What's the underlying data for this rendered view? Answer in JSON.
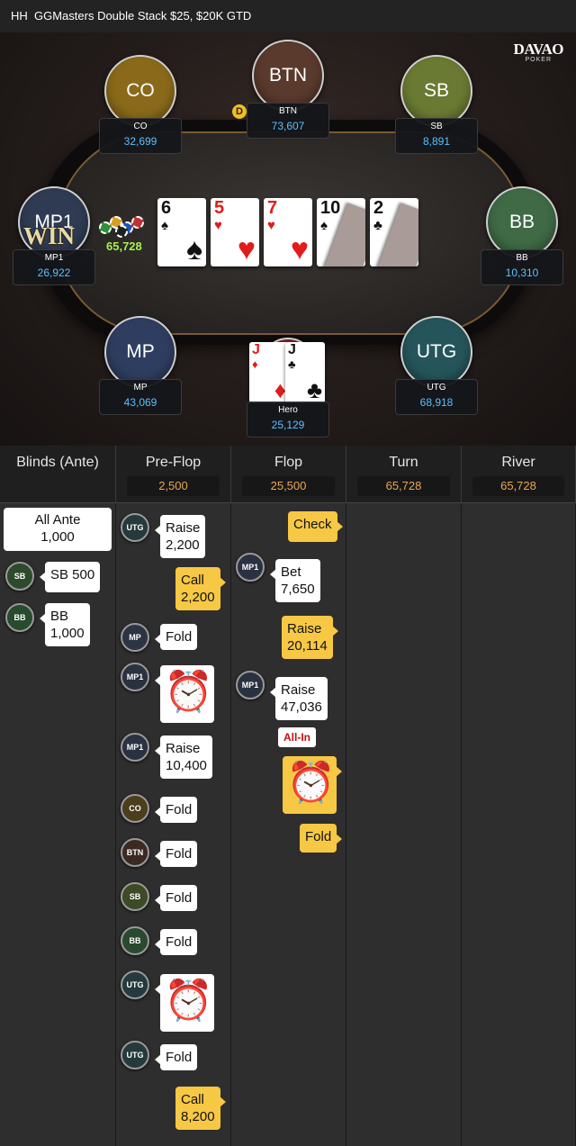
{
  "header": {
    "title": "HH  GGMasters Double Stack $25, $20K GTD"
  },
  "logo": {
    "main": "DAVAO",
    "sub": "POKER"
  },
  "seats": [
    {
      "key": "co",
      "label": "CO",
      "name": "CO",
      "stack": "32,699",
      "color": "#8a6a1a"
    },
    {
      "key": "btn",
      "label": "BTN",
      "name": "BTN",
      "stack": "73,607",
      "color": "#5a3a2c"
    },
    {
      "key": "sb",
      "label": "SB",
      "name": "SB",
      "stack": "8,891",
      "color": "#6a7a32"
    },
    {
      "key": "mp1",
      "label": "MP1",
      "name": "MP1",
      "stack": "26,922",
      "color": "#2e3b52"
    },
    {
      "key": "bb",
      "label": "BB",
      "name": "BB",
      "stack": "10,310",
      "color": "#3f6a45"
    },
    {
      "key": "mp",
      "label": "MP",
      "name": "MP",
      "stack": "43,069",
      "color": "#2f3e60"
    },
    {
      "key": "utg",
      "label": "UTG",
      "name": "UTG",
      "stack": "68,918",
      "color": "#25555a"
    },
    {
      "key": "hero",
      "label": "",
      "name": "Hero",
      "stack": "25,129",
      "color": "#7a2020"
    }
  ],
  "dealer_button": "D",
  "win_label": "WIN",
  "pot_amount": "65,728",
  "board": [
    {
      "rank": "6",
      "suit": "♠",
      "color": "black",
      "folded": false
    },
    {
      "rank": "5",
      "suit": "♥",
      "color": "red",
      "folded": false
    },
    {
      "rank": "7",
      "suit": "♥",
      "color": "red",
      "folded": false
    },
    {
      "rank": "10",
      "suit": "♠",
      "color": "black",
      "folded": true
    },
    {
      "rank": "2",
      "suit": "♣",
      "color": "black",
      "folded": true
    }
  ],
  "hero_cards": [
    {
      "rank": "J",
      "suit": "♦",
      "color": "red"
    },
    {
      "rank": "J",
      "suit": "♣",
      "color": "black"
    }
  ],
  "columns": [
    {
      "title": "Blinds (Ante)",
      "value": ""
    },
    {
      "title": "Pre-Flop",
      "value": "2,500"
    },
    {
      "title": "Flop",
      "value": "25,500"
    },
    {
      "title": "Turn",
      "value": "65,728"
    },
    {
      "title": "River",
      "value": "65,728"
    }
  ],
  "blinds": {
    "ante_label": "All Ante",
    "ante_value": "1,000",
    "sb_pos": "SB",
    "sb_text": "SB  500",
    "bb_pos": "BB",
    "bb_action": "BB",
    "bb_amount": "1,000"
  },
  "preflop": [
    {
      "pos": "UTG",
      "action": "Raise",
      "amount": "2,200"
    },
    {
      "hero": true,
      "action": "Call",
      "amount": "2,200"
    },
    {
      "pos": "MP",
      "action": "Fold"
    },
    {
      "pos": "MP1",
      "action": "timer"
    },
    {
      "pos": "MP1",
      "action": "Raise",
      "amount": "10,400"
    },
    {
      "pos": "CO",
      "action": "Fold"
    },
    {
      "pos": "BTN",
      "action": "Fold"
    },
    {
      "pos": "SB",
      "action": "Fold"
    },
    {
      "pos": "BB",
      "action": "Fold"
    },
    {
      "pos": "UTG",
      "action": "timer"
    },
    {
      "pos": "UTG",
      "action": "Fold"
    },
    {
      "hero": true,
      "action": "Call",
      "amount": "8,200"
    }
  ],
  "flop": [
    {
      "hero": true,
      "action": "Check"
    },
    {
      "pos": "MP1",
      "action": "Bet",
      "amount": "7,650"
    },
    {
      "hero": true,
      "action": "Raise",
      "amount": "20,114"
    },
    {
      "pos": "MP1",
      "action": "Raise",
      "amount": "47,036",
      "tag": "All-In"
    },
    {
      "hero": true,
      "action": "timer"
    },
    {
      "hero": true,
      "action": "Fold"
    }
  ]
}
